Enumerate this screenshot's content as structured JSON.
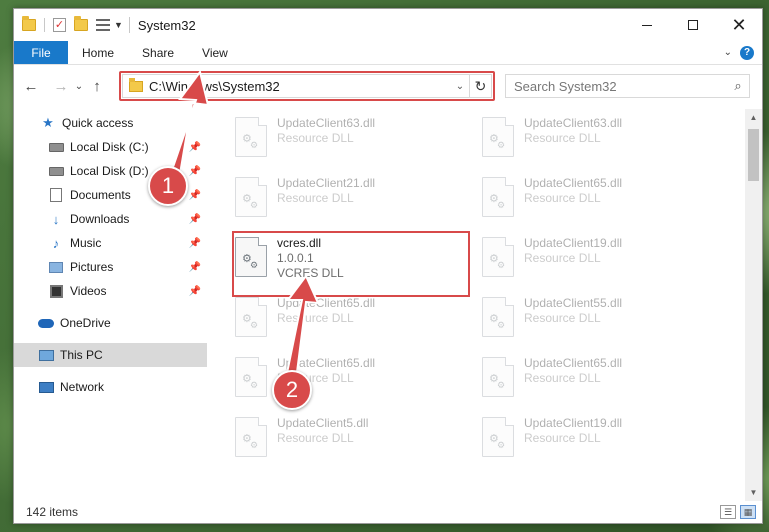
{
  "window": {
    "title": "System32"
  },
  "ribbon": {
    "tabs": [
      {
        "label": "File"
      },
      {
        "label": "Home"
      },
      {
        "label": "Share"
      },
      {
        "label": "View"
      }
    ],
    "help": "?"
  },
  "nav": {
    "back": "←",
    "forward": "→",
    "recent": "⌄",
    "up": "↑"
  },
  "address": {
    "path": "C:\\Windows\\System32"
  },
  "search": {
    "placeholder": "Search System32"
  },
  "sidebar": {
    "items": [
      {
        "label": "Quick access",
        "icon": "star-icon"
      },
      {
        "label": "Local Disk (C:)",
        "icon": "drive-icon",
        "pinned": true
      },
      {
        "label": "Local Disk (D:)",
        "icon": "drive-icon",
        "pinned": true
      },
      {
        "label": "Documents",
        "icon": "documents-icon",
        "pinned": true
      },
      {
        "label": "Downloads",
        "icon": "download-icon",
        "pinned": true
      },
      {
        "label": "Music",
        "icon": "music-icon",
        "pinned": true
      },
      {
        "label": "Pictures",
        "icon": "pictures-icon",
        "pinned": true
      },
      {
        "label": "Videos",
        "icon": "videos-icon",
        "pinned": true
      },
      {
        "label": "OneDrive",
        "icon": "cloud-icon"
      },
      {
        "label": "This PC",
        "icon": "computer-icon",
        "selected": true
      },
      {
        "label": "Network",
        "icon": "network-icon"
      }
    ]
  },
  "files": [
    {
      "name": "UpdateClient63.dll",
      "meta": "Resource DLL"
    },
    {
      "name": "UpdateClient63.dll",
      "meta": "Resource DLL"
    },
    {
      "name": "UpdateClient21.dll",
      "meta": "Resource DLL"
    },
    {
      "name": "UpdateClient65.dll",
      "meta": "Resource DLL"
    },
    {
      "name": "vcres.dll",
      "version": "1.0.0.1",
      "meta": "VCRES DLL"
    },
    {
      "name": "UpdateClient19.dll",
      "meta": "Resource DLL"
    },
    {
      "name": "UpdateClient65.dll",
      "meta": "Resource DLL"
    },
    {
      "name": "UpdateClient55.dll",
      "meta": "Resource DLL"
    },
    {
      "name": "UpdateClient65.dll",
      "meta": "Resource DLL"
    },
    {
      "name": "UpdateClient65.dll",
      "meta": "Resource DLL"
    },
    {
      "name": "UpdateClient5.dll",
      "meta": "Resource DLL"
    },
    {
      "name": "UpdateClient19.dll",
      "meta": "Resource DLL"
    }
  ],
  "status": {
    "count": "142 items"
  },
  "annotations": {
    "step1": "1",
    "step2": "2",
    "color": "#d84a4a"
  }
}
